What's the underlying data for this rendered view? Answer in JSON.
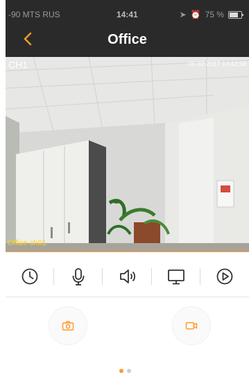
{
  "status_bar": {
    "carrier": "-90 MTS RUS",
    "time": "14:41",
    "battery_percent": "75 %"
  },
  "nav_bar": {
    "title": "Office",
    "back_icon": "chevron-left-icon"
  },
  "video": {
    "channel": "CH1",
    "timestamp": "06-02-2017 14:42:58",
    "camera_name": "Office ch01"
  },
  "toolbar": {
    "items": [
      {
        "icon": "clock-icon"
      },
      {
        "icon": "microphone-icon"
      },
      {
        "icon": "speaker-icon"
      },
      {
        "icon": "monitor-icon"
      },
      {
        "icon": "play-icon"
      }
    ]
  },
  "actions": {
    "snapshot_icon": "camera-icon",
    "record_icon": "video-camera-icon"
  },
  "pager": {
    "pages": 2,
    "active_index": 0
  },
  "colors": {
    "accent": "#ff9a2a",
    "nav_bg": "#2a2a2a",
    "osd_yellow": "#ffd400",
    "icon_dark": "#333333"
  }
}
